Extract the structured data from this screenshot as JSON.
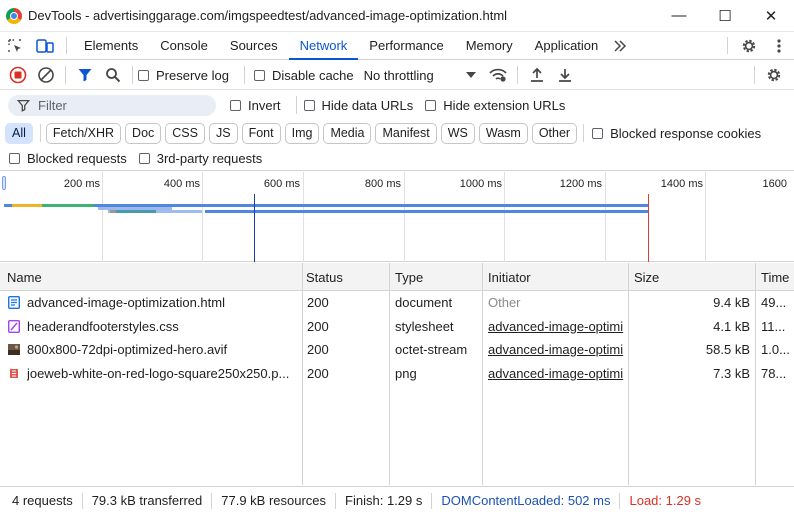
{
  "window": {
    "title": "DevTools - advertisinggarage.com/imgspeedtest/advanced-image-optimization.html",
    "minimize": "—",
    "maximize": "☐",
    "close": "✕"
  },
  "tabs": [
    "Elements",
    "Console",
    "Sources",
    "Network",
    "Performance",
    "Memory",
    "Application"
  ],
  "active_tab": "Network",
  "toolbar": {
    "preserve_log": "Preserve log",
    "disable_cache": "Disable cache",
    "throttling": "No throttling"
  },
  "filter": {
    "placeholder": "Filter",
    "invert": "Invert",
    "hide_data_urls": "Hide data URLs",
    "hide_extension_urls": "Hide extension URLs"
  },
  "type_filters": [
    "All",
    "Fetch/XHR",
    "Doc",
    "CSS",
    "JS",
    "Font",
    "Img",
    "Media",
    "Manifest",
    "WS",
    "Wasm",
    "Other"
  ],
  "active_type_filter": "All",
  "blocked_response_cookies": "Blocked response cookies",
  "blocked_requests": "Blocked requests",
  "third_party_requests": "3rd-party requests",
  "overview": {
    "ticks": [
      "200 ms",
      "400 ms",
      "600 ms",
      "800 ms",
      "1000 ms",
      "1200 ms",
      "1400 ms",
      "1600"
    ],
    "dom_content_loaded_ms": 502,
    "load_ms": 1290
  },
  "columns": [
    "Name",
    "Status",
    "Type",
    "Initiator",
    "Size",
    "Time"
  ],
  "requests": [
    {
      "name": "advanced-image-optimization.html",
      "status": "200",
      "type": "document",
      "initiator": "Other",
      "size": "9.4 kB",
      "time": "49...",
      "icon": "document-icon"
    },
    {
      "name": "headerandfooterstyles.css",
      "status": "200",
      "type": "stylesheet",
      "initiator": "advanced-image-optimi",
      "size": "4.1 kB",
      "time": "11...",
      "icon": "stylesheet-icon"
    },
    {
      "name": "800x800-72dpi-optimized-hero.avif",
      "status": "200",
      "type": "octet-stream",
      "initiator": "advanced-image-optimi",
      "size": "58.5 kB",
      "time": "1.0...",
      "icon": "image-thumbnail-icon"
    },
    {
      "name": "joeweb-white-on-red-logo-square250x250.p...",
      "status": "200",
      "type": "png",
      "initiator": "advanced-image-optimi",
      "size": "7.3 kB",
      "time": "78...",
      "icon": "logo-thumbnail-icon"
    }
  ],
  "status": {
    "requests": "4 requests",
    "transferred": "79.3 kB transferred",
    "resources": "77.9 kB resources",
    "finish": "Finish: 1.29 s",
    "dcl": "DOMContentLoaded: 502 ms",
    "load": "Load: 1.29 s"
  },
  "colors": {
    "accent": "#0b57d0",
    "dcl_line": "#1a3ea8",
    "load_line": "#e53935",
    "status_dcl": "#1a53b3",
    "status_load": "#d93025"
  }
}
